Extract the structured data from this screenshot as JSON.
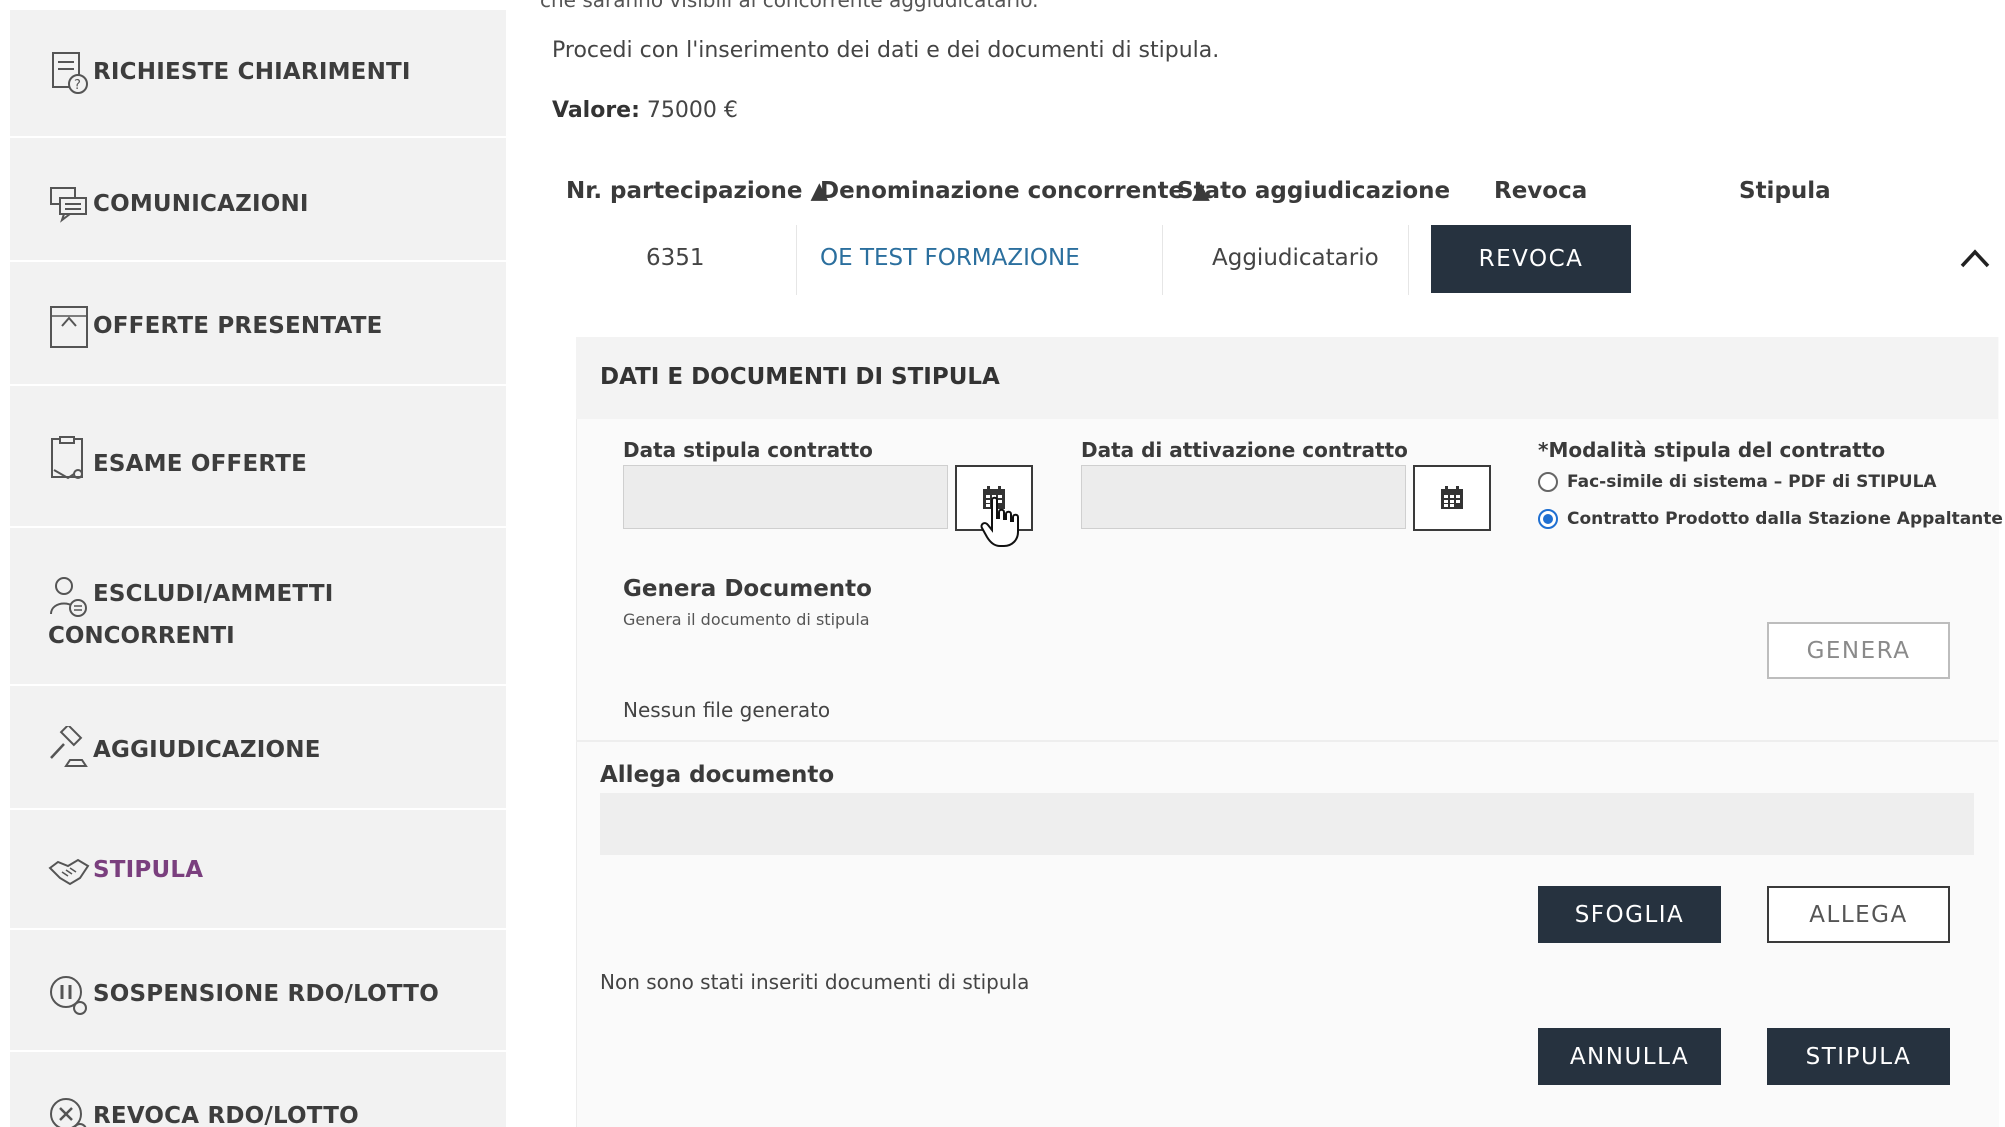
{
  "sidebar": {
    "items": [
      {
        "label": "RICHIESTE CHIARIMENTI",
        "icon": "document-question-icon"
      },
      {
        "label": "COMUNICAZIONI",
        "icon": "chat-bubbles-icon"
      },
      {
        "label": "OFFERTE PRESENTATE",
        "icon": "offer-board-icon"
      },
      {
        "label": "ESAME OFFERTE",
        "icon": "document-review-icon"
      },
      {
        "label": "ESCLUDI/AMMETTI",
        "label_line2": "CONCORRENTI",
        "icon": "user-settings-icon"
      },
      {
        "label": "AGGIUDICAZIONE",
        "icon": "gavel-icon"
      },
      {
        "label": "STIPULA",
        "icon": "handshake-icon",
        "active": true
      },
      {
        "label": "SOSPENSIONE RDO/LOTTO",
        "icon": "pause-circle-icon"
      },
      {
        "label": "REVOCA RDO/LOTTO",
        "icon": "cancel-circle-icon"
      }
    ]
  },
  "main": {
    "top_cut_text": "che saranno visibili al concorrente aggiudicatario.",
    "intro_text": "Procedi con l'inserimento dei dati e dei documenti di stipula.",
    "valore_label": "Valore:",
    "valore_value": "75000 €",
    "table": {
      "headers": [
        "Nr. partecipazione ▲",
        "Denominazione concorrente ▲",
        "Stato aggiudicazione",
        "Revoca",
        "Stipula"
      ],
      "row": {
        "nr": "6351",
        "denominazione": "OE TEST FORMAZIONE",
        "stato": "Aggiudicatario",
        "revoca_button": "REVOCA"
      }
    },
    "panel": {
      "title": "DATI E DOCUMENTI DI STIPULA",
      "data_stipula_label": "Data stipula contratto",
      "data_stipula_value": "",
      "data_attivazione_label": "Data di attivazione contratto",
      "data_attivazione_value": "",
      "modalita_label": "*Modalità stipula del contratto",
      "modalita_options": [
        {
          "label": "Fac-simile di sistema – PDF di STIPULA",
          "checked": false
        },
        {
          "label": "Contratto Prodotto dalla Stazione Appaltante",
          "checked": true
        }
      ],
      "genera_title": "Genera Documento",
      "genera_subtitle": "Genera il documento di stipula",
      "genera_button": "GENERA",
      "nessun_file": "Nessun file generato",
      "allega_title": "Allega documento",
      "sfoglia_button": "SFOGLIA",
      "allega_button": "ALLEGA",
      "no_docs_text": "Non sono stati inseriti documenti di stipula",
      "annulla_button": "ANNULLA",
      "stipula_button": "STIPULA"
    }
  },
  "colors": {
    "dark_button": "#26323f",
    "active_sidebar": "#7a3f7e",
    "link": "#2b6f9e",
    "radio_checked": "#1f6fd1"
  }
}
